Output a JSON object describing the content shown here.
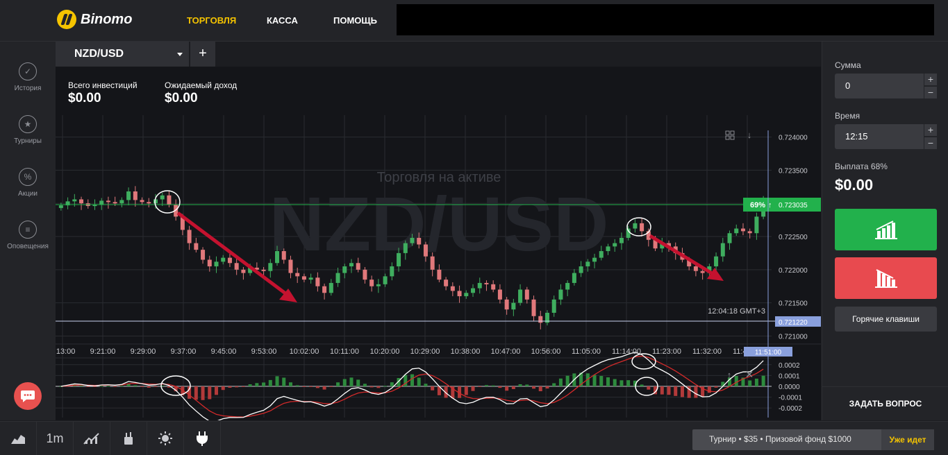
{
  "app": {
    "brand": "Binomo"
  },
  "nav": [
    "ТОРГОВЛЯ",
    "КАССА",
    "ПОМОЩЬ"
  ],
  "sidebar": {
    "items": [
      {
        "label": "История",
        "icon": "check-circle-icon"
      },
      {
        "label": "Турниры",
        "icon": "trophy-icon"
      },
      {
        "label": "Акции",
        "icon": "percent-icon"
      },
      {
        "label": "Оповещения",
        "icon": "bell-list-icon"
      }
    ]
  },
  "tab": {
    "label": "NZD/USD",
    "add_label": "+"
  },
  "investments": {
    "total_label": "Всего инвестиций",
    "total_value": "$0.00",
    "expected_label": "Ожидаемый доход",
    "expected_value": "$0.00"
  },
  "chart_overlay": {
    "watermark": "NZD/USD",
    "subtitle": "Торговля на активе",
    "time_label": "12:04:18 GMT+3",
    "current_price": "0.723035",
    "payout_badge": "69%",
    "low_price": "0.721220",
    "current_time": "11:51:00"
  },
  "chart_data": [
    {
      "type": "candlestick",
      "x_ticks": [
        "9:13:00",
        "9:21:00",
        "9:29:00",
        "9:37:00",
        "9:45:00",
        "9:53:00",
        "10:02:00",
        "10:11:00",
        "10:20:00",
        "10:29:00",
        "10:38:00",
        "10:47:00",
        "10:56:00",
        "11:05:00",
        "11:14:00",
        "11:23:00",
        "11:32:00",
        "11:41:00"
      ],
      "y_ticks": [
        "0.724000",
        "0.723500",
        "0.723000",
        "0.722500",
        "0.722000",
        "0.721500",
        "0.721000"
      ],
      "ylim": [
        0.7209,
        0.7241
      ],
      "close": [
        0.72297,
        0.72303,
        0.72306,
        0.723,
        0.72296,
        0.72298,
        0.72304,
        0.72302,
        0.723,
        0.72305,
        0.72318,
        0.72305,
        0.72302,
        0.723,
        0.72306,
        0.72312,
        0.72298,
        0.7228,
        0.7226,
        0.7224,
        0.7223,
        0.72215,
        0.72205,
        0.72212,
        0.72218,
        0.7221,
        0.722,
        0.72195,
        0.72203,
        0.722,
        0.72198,
        0.7221,
        0.72228,
        0.72215,
        0.72195,
        0.7219,
        0.72185,
        0.72188,
        0.72175,
        0.72165,
        0.7218,
        0.72195,
        0.72205,
        0.7221,
        0.722,
        0.72185,
        0.72175,
        0.72178,
        0.7219,
        0.72205,
        0.72225,
        0.7224,
        0.72248,
        0.72238,
        0.7222,
        0.722,
        0.72185,
        0.72175,
        0.72168,
        0.7216,
        0.72165,
        0.72172,
        0.7218,
        0.72178,
        0.7217,
        0.72155,
        0.7214,
        0.7215,
        0.7217,
        0.72155,
        0.7213,
        0.7212,
        0.72135,
        0.72155,
        0.7217,
        0.7218,
        0.72195,
        0.72205,
        0.72212,
        0.72218,
        0.72228,
        0.72235,
        0.7224,
        0.72248,
        0.72262,
        0.7227,
        0.72258,
        0.72245,
        0.72232,
        0.7224,
        0.72235,
        0.72225,
        0.72215,
        0.72205,
        0.72198,
        0.72195,
        0.72205,
        0.7222,
        0.7224,
        0.72255,
        0.72262,
        0.72258,
        0.72255,
        0.7228,
        0.72303
      ]
    },
    {
      "type": "line",
      "series": [
        {
          "values": []
        },
        {
          "values": []
        }
      ],
      "y_ticks": [
        "0.0002",
        "0.0001",
        "0.0000",
        "-0.0001",
        "-0.0002"
      ],
      "ylim": [
        -0.00025,
        0.00025
      ]
    }
  ],
  "trade": {
    "amount_label": "Сумма",
    "amount_value": "0",
    "time_label": "Время",
    "time_value": "12:15",
    "payout_label": "Выплата 68%",
    "payout_value": "$0.00",
    "hotkeys_label": "Горячие клавиши",
    "ask_label": "ЗАДАТЬ ВОПРОС"
  },
  "bottombar": {
    "timeframe": "1m",
    "tournament_text": "Турнир • $35 • Призовой фонд $1000",
    "tournament_status": "Уже идет"
  },
  "colors": {
    "accent": "#f5c400",
    "up": "#22b14c",
    "down": "#e84a4f",
    "arrows": "#c4122f"
  }
}
